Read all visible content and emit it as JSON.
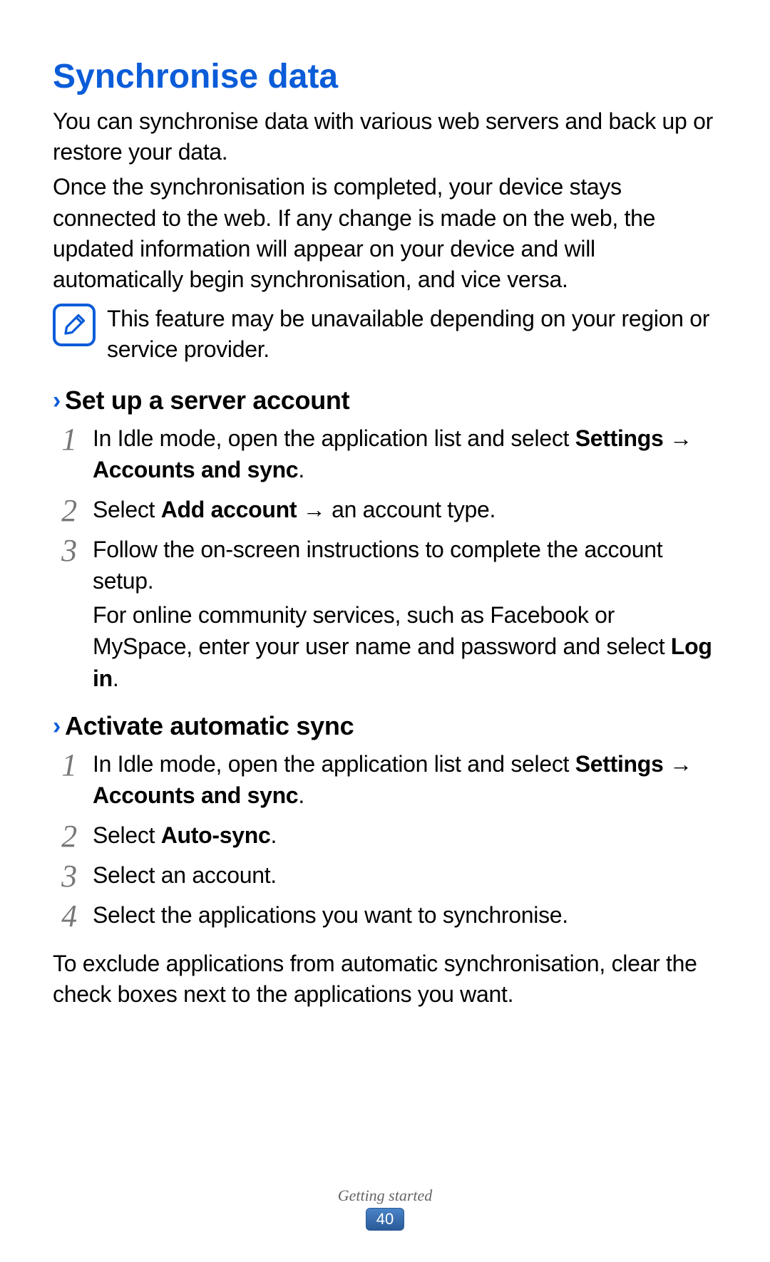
{
  "title": "Synchronise data",
  "intro1": "You can synchronise data with various web servers and back up or restore your data.",
  "intro2": "Once the synchronisation is completed, your device stays connected to the web. If any change is made on the web, the updated information will appear on your device and will automatically begin synchronisation, and vice versa.",
  "note": "This feature may be unavailable depending on your region or service provider.",
  "sections": [
    {
      "heading": "Set up a server account",
      "steps": [
        {
          "pre": "In Idle mode, open the application list and select ",
          "bold1": "Settings",
          "mid": " → ",
          "bold2": "Accounts and sync",
          "post": "."
        },
        {
          "pre": "Select ",
          "bold1": "Add account",
          "mid": " → an account type.",
          "bold2": "",
          "post": ""
        },
        {
          "pre": "Follow the on-screen instructions to complete the account setup.",
          "cont_pre": "For online community services, such as Facebook or MySpace, enter your user name and password and select ",
          "cont_bold": "Log in",
          "cont_post": "."
        }
      ]
    },
    {
      "heading": "Activate automatic sync",
      "steps": [
        {
          "pre": "In Idle mode, open the application list and select ",
          "bold1": "Settings",
          "mid": " → ",
          "bold2": "Accounts and sync",
          "post": "."
        },
        {
          "pre": "Select ",
          "bold1": "Auto-sync",
          "post": "."
        },
        {
          "pre": "Select an account."
        },
        {
          "pre": "Select the applications you want to synchronise."
        }
      ],
      "trailing": "To exclude applications from automatic synchronisation, clear the check boxes next to the applications you want."
    }
  ],
  "footer": {
    "section": "Getting started",
    "page": "40"
  }
}
